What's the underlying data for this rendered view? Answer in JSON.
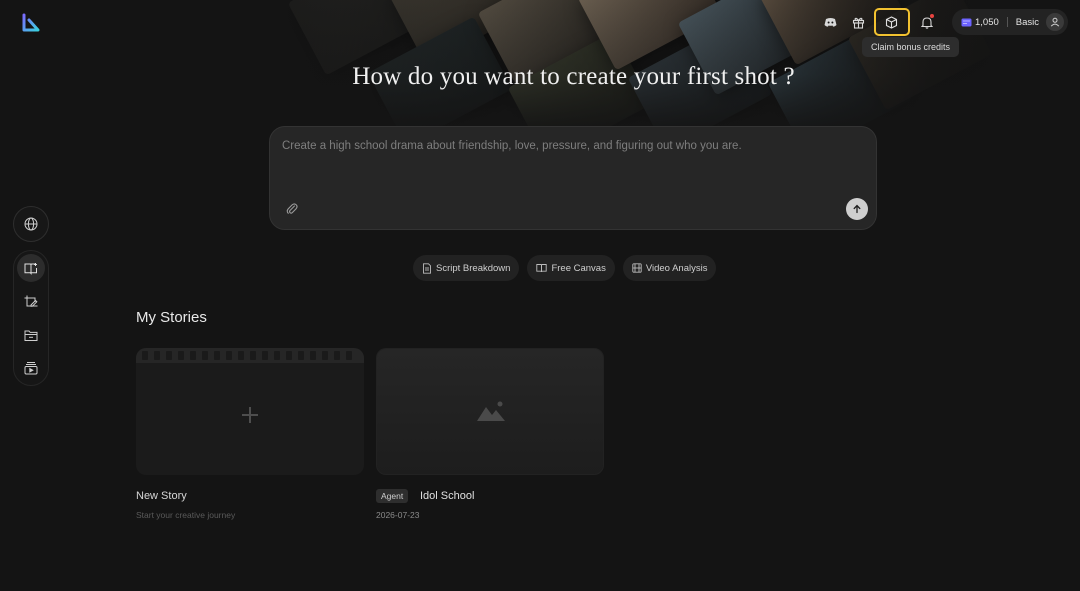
{
  "topbar": {
    "credits": "1,050",
    "plan": "Basic",
    "tooltip": "Claim bonus credits"
  },
  "hero": {
    "headline": "How do you want to create your first shot ?"
  },
  "prompt": {
    "placeholder": "Create a high school drama about friendship, love, pressure, and figuring out who you are."
  },
  "modes": [
    {
      "label": "Script Breakdown",
      "icon": "document-icon"
    },
    {
      "label": "Free Canvas",
      "icon": "book-icon"
    },
    {
      "label": "Video Analysis",
      "icon": "film-icon"
    }
  ],
  "sidebar": {
    "globe": "globe-icon",
    "items": [
      {
        "icon": "story-book-icon",
        "active": true
      },
      {
        "icon": "crop-edit-icon",
        "active": false
      },
      {
        "icon": "folder-icon",
        "active": false
      },
      {
        "icon": "video-library-icon",
        "active": false
      }
    ]
  },
  "stories": {
    "title": "My Stories",
    "new_story": {
      "title": "New Story",
      "subtitle": "Start your creative journey"
    },
    "items": [
      {
        "badge": "Agent",
        "title": "Idol School",
        "date": "2026-07-23"
      }
    ]
  },
  "colors": {
    "background": "#141414",
    "highlight": "#f2c230",
    "notification": "#e8433f",
    "credit_icon": "#6c63ff"
  }
}
